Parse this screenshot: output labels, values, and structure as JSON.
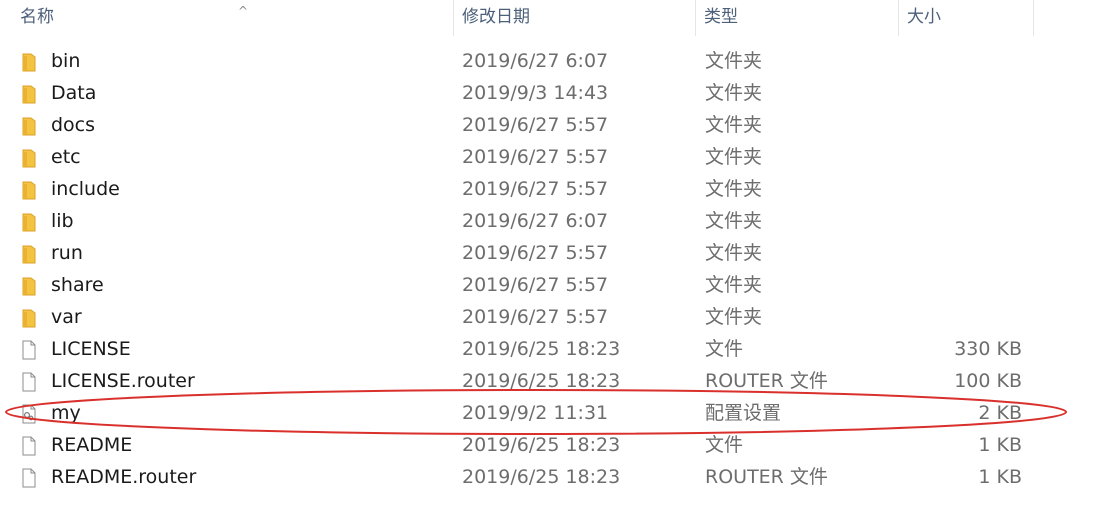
{
  "columns": {
    "name": "名称",
    "date": "修改日期",
    "type": "类型",
    "size": "大小"
  },
  "sort_indicator": "^",
  "rows": [
    {
      "icon": "folder-icon",
      "name": "bin",
      "date": "2019/6/27 6:07",
      "type": "文件夹",
      "size": ""
    },
    {
      "icon": "folder-icon",
      "name": "Data",
      "date": "2019/9/3 14:43",
      "type": "文件夹",
      "size": ""
    },
    {
      "icon": "folder-icon",
      "name": "docs",
      "date": "2019/6/27 5:57",
      "type": "文件夹",
      "size": ""
    },
    {
      "icon": "folder-icon",
      "name": "etc",
      "date": "2019/6/27 5:57",
      "type": "文件夹",
      "size": ""
    },
    {
      "icon": "folder-icon",
      "name": "include",
      "date": "2019/6/27 5:57",
      "type": "文件夹",
      "size": ""
    },
    {
      "icon": "folder-icon",
      "name": "lib",
      "date": "2019/6/27 6:07",
      "type": "文件夹",
      "size": ""
    },
    {
      "icon": "folder-icon",
      "name": "run",
      "date": "2019/6/27 5:57",
      "type": "文件夹",
      "size": ""
    },
    {
      "icon": "folder-icon",
      "name": "share",
      "date": "2019/6/27 5:57",
      "type": "文件夹",
      "size": ""
    },
    {
      "icon": "folder-icon",
      "name": "var",
      "date": "2019/6/27 5:57",
      "type": "文件夹",
      "size": ""
    },
    {
      "icon": "file-icon",
      "name": "LICENSE",
      "date": "2019/6/25 18:23",
      "type": "文件",
      "size": "330 KB"
    },
    {
      "icon": "file-icon",
      "name": "LICENSE.router",
      "date": "2019/6/25 18:23",
      "type": "ROUTER 文件",
      "size": "100 KB"
    },
    {
      "icon": "config-file-icon",
      "name": "my",
      "date": "2019/9/2 11:31",
      "type": "配置设置",
      "size": "2 KB"
    },
    {
      "icon": "file-icon",
      "name": "README",
      "date": "2019/6/25 18:23",
      "type": "文件",
      "size": "1 KB"
    },
    {
      "icon": "file-icon",
      "name": "README.router",
      "date": "2019/6/25 18:23",
      "type": "ROUTER 文件",
      "size": "1 KB"
    }
  ],
  "colors": {
    "folder": "#f5c342",
    "header_text": "#4c607a",
    "highlight_ring": "#d9302c"
  }
}
